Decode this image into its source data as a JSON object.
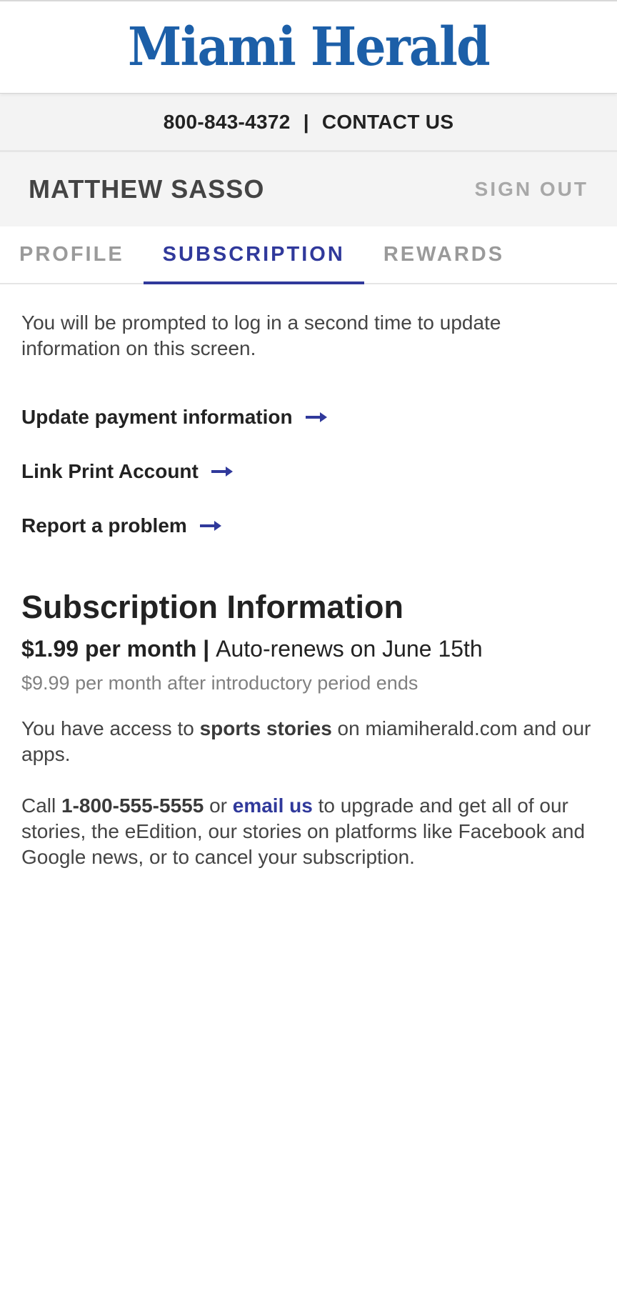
{
  "masthead": {
    "logo_text": "Miami Herald"
  },
  "contact_bar": {
    "phone": "800-843-4372",
    "separator": "|",
    "contact_label": "CONTACT US"
  },
  "user_bar": {
    "name": "MATTHEW SASSO",
    "sign_out_label": "SIGN OUT"
  },
  "tabs": [
    {
      "label": "PROFILE",
      "active": false
    },
    {
      "label": "SUBSCRIPTION",
      "active": true
    },
    {
      "label": "REWARDS",
      "active": false
    }
  ],
  "notice": "You will be prompted to log in a second time to update information on this screen.",
  "links": [
    {
      "label": "Update payment information",
      "icon": "arrow-right-icon"
    },
    {
      "label": "Link Print Account",
      "icon": "arrow-right-icon"
    },
    {
      "label": "Report a problem",
      "icon": "arrow-right-icon"
    }
  ],
  "subscription": {
    "title": "Subscription Information",
    "price": "$1.99 per month",
    "price_separator": " | ",
    "renewal": "Auto-renews on June 15th",
    "after_intro": "$9.99 per month after introductory period ends",
    "access_prefix": "You have access to ",
    "access_bold": "sports stories",
    "access_suffix": " on miamiherald.com and our apps.",
    "call_prefix": "Call ",
    "call_phone": "1-800-555-5555",
    "call_or": " or ",
    "call_email": "email us",
    "call_suffix": " to upgrade and get all of our stories, the eEdition, our stories on platforms like Facebook and Google news, or to cancel your subscription."
  },
  "colors": {
    "brand_blue": "#1c5fa8",
    "accent": "#30399b",
    "muted": "#a8a8a8"
  }
}
